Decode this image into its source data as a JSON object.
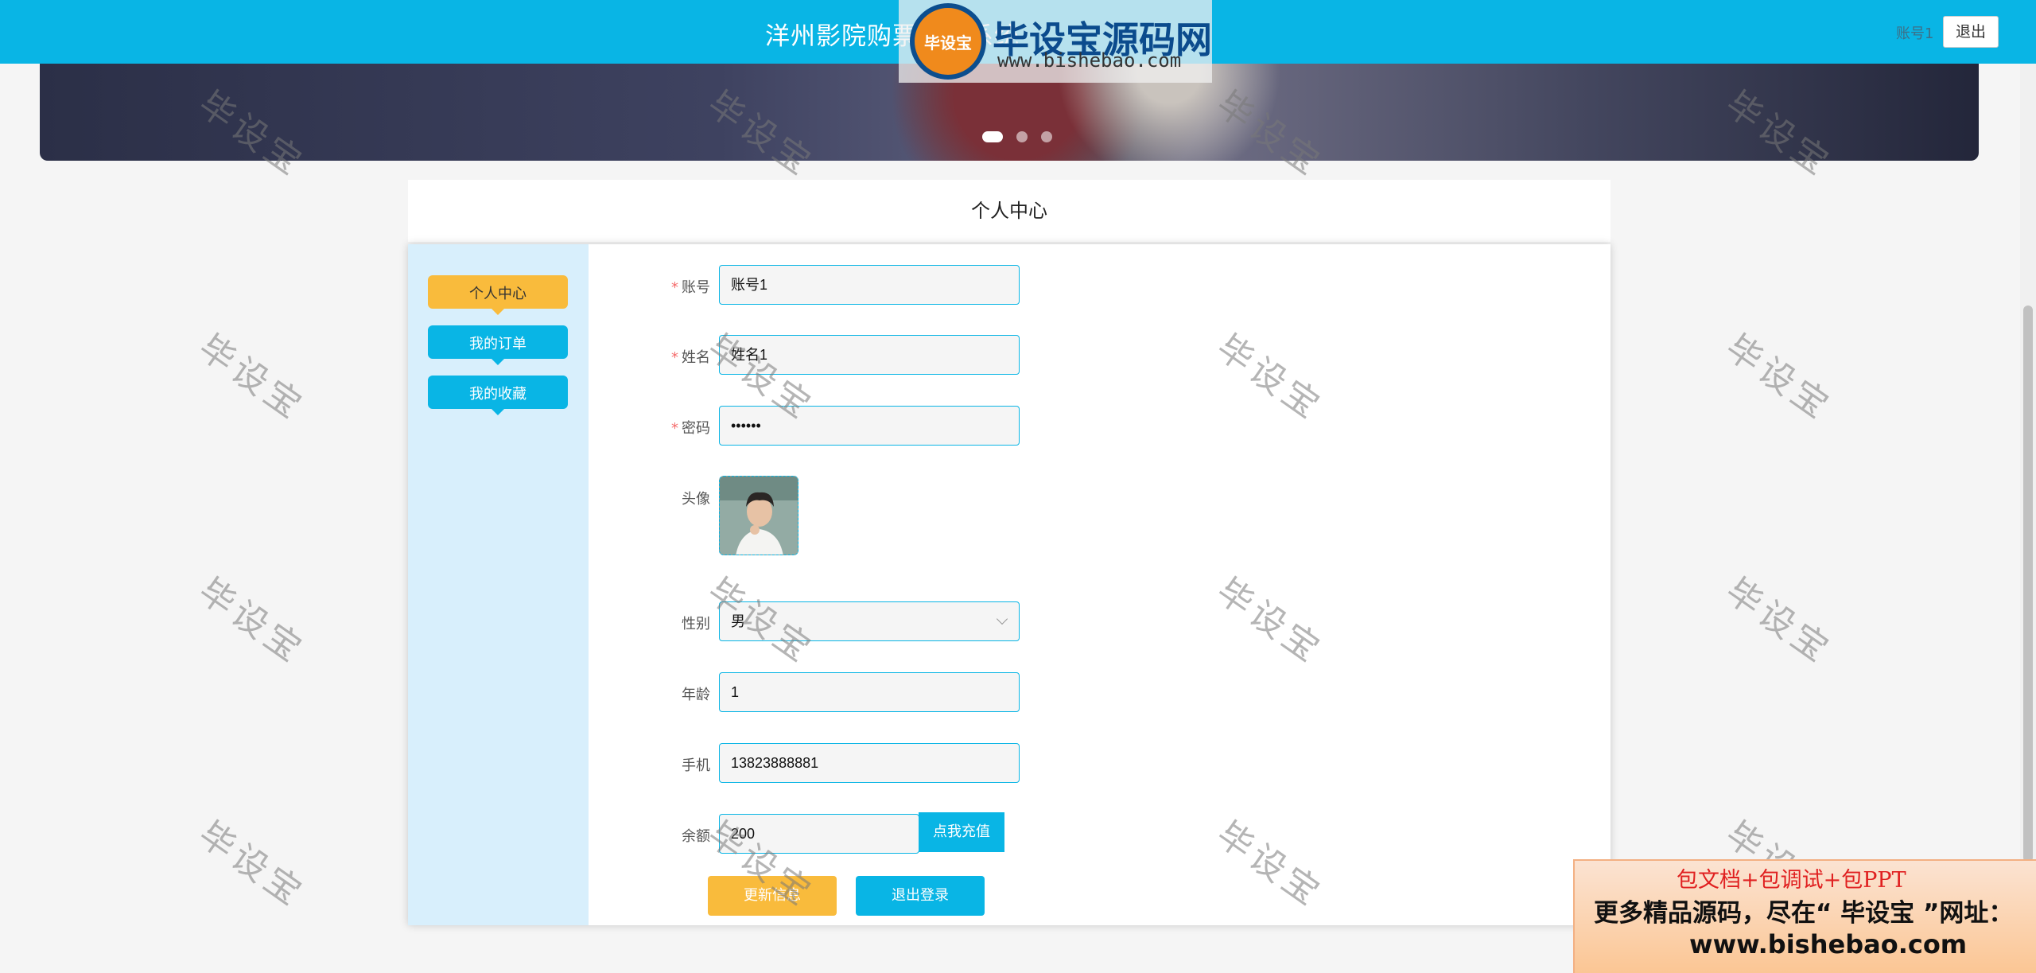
{
  "header": {
    "title": "洋州影院购票管理系统",
    "account": "账号1",
    "logout_label": "退出"
  },
  "watermark_logo": {
    "badge_text": "毕设宝",
    "name": "毕设宝源码网",
    "url": "www.bishebao.com"
  },
  "banner": {
    "slides": 3,
    "active_slide": 1
  },
  "page": {
    "title": "个人中心"
  },
  "sidebar": {
    "items": [
      {
        "label": "个人中心",
        "active": true
      },
      {
        "label": "我的订单",
        "active": false
      },
      {
        "label": "我的收藏",
        "active": false
      }
    ]
  },
  "form": {
    "account_label": "账号",
    "account_value": "账号1",
    "name_label": "姓名",
    "name_value": "姓名1",
    "password_label": "密码",
    "password_value": "••••••",
    "avatar_label": "头像",
    "gender_label": "性别",
    "gender_value": "男",
    "age_label": "年龄",
    "age_value": "1",
    "phone_label": "手机",
    "phone_value": "13823888881",
    "balance_label": "余额",
    "balance_value": "200",
    "recharge_label": "点我充值",
    "update_label": "更新信息",
    "logout_label": "退出登录"
  },
  "watermark_text": "毕设宝",
  "ad": {
    "line1": "包文档+包调试+包PPT",
    "line2": "更多精品源码，尽在“ 毕设宝 ”网址：",
    "line3": "www.bishebao.com"
  },
  "colors": {
    "primary": "#09b5e5",
    "accent": "#f9bb3c",
    "sidebar_bg": "#d8effc"
  }
}
